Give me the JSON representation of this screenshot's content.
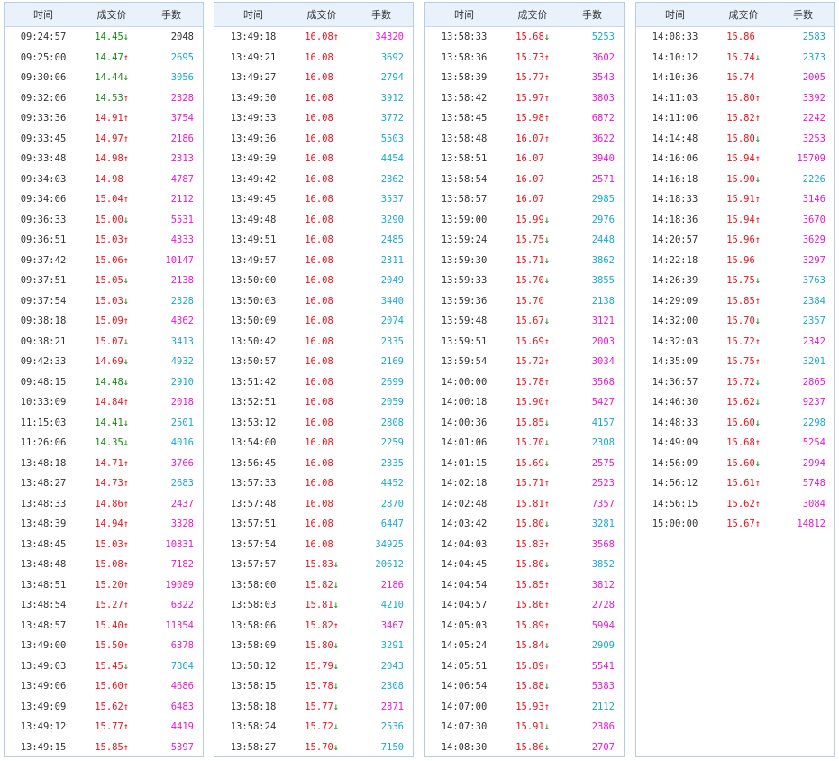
{
  "headers": {
    "time": "时间",
    "price": "成交价",
    "volume": "手数"
  },
  "colors": {
    "up": "#e8141e",
    "down": "#148a14",
    "buy": "#e619d3",
    "sell": "#1ba8cf"
  },
  "panels": [
    [
      [
        "09:24:57",
        "14.45",
        "d",
        "2048",
        "n",
        "g"
      ],
      [
        "09:25:00",
        "14.47",
        "u",
        "2695",
        "s",
        "g"
      ],
      [
        "09:30:06",
        "14.44",
        "d",
        "3056",
        "s",
        "g"
      ],
      [
        "09:32:06",
        "14.53",
        "u",
        "2328",
        "b",
        "g"
      ],
      [
        "09:33:36",
        "14.91",
        "u",
        "3754",
        "b",
        "r"
      ],
      [
        "09:33:45",
        "14.97",
        "u",
        "2186",
        "b",
        "r"
      ],
      [
        "09:33:48",
        "14.98",
        "u",
        "2313",
        "b",
        "r"
      ],
      [
        "09:34:03",
        "14.98",
        "",
        "4787",
        "b",
        "r"
      ],
      [
        "09:34:06",
        "15.04",
        "u",
        "2112",
        "b",
        "r"
      ],
      [
        "09:36:33",
        "15.00",
        "d",
        "5531",
        "b",
        "r"
      ],
      [
        "09:36:51",
        "15.03",
        "u",
        "4333",
        "b",
        "r"
      ],
      [
        "09:37:42",
        "15.06",
        "u",
        "10147",
        "b",
        "r"
      ],
      [
        "09:37:51",
        "15.05",
        "d",
        "2138",
        "b",
        "r"
      ],
      [
        "09:37:54",
        "15.03",
        "d",
        "2328",
        "s",
        "r"
      ],
      [
        "09:38:18",
        "15.09",
        "u",
        "4362",
        "b",
        "r"
      ],
      [
        "09:38:21",
        "15.07",
        "d",
        "3413",
        "s",
        "r"
      ],
      [
        "09:42:33",
        "14.69",
        "d",
        "4932",
        "s",
        "r"
      ],
      [
        "09:48:15",
        "14.48",
        "d",
        "2910",
        "s",
        "g"
      ],
      [
        "10:33:09",
        "14.84",
        "u",
        "2018",
        "b",
        "r"
      ],
      [
        "11:15:03",
        "14.41",
        "d",
        "2501",
        "s",
        "g"
      ],
      [
        "11:26:06",
        "14.35",
        "d",
        "4016",
        "s",
        "g"
      ],
      [
        "13:48:18",
        "14.71",
        "u",
        "3766",
        "b",
        "r"
      ],
      [
        "13:48:27",
        "14.73",
        "u",
        "2683",
        "s",
        "r"
      ],
      [
        "13:48:33",
        "14.86",
        "u",
        "2437",
        "b",
        "r"
      ],
      [
        "13:48:39",
        "14.94",
        "u",
        "3328",
        "b",
        "r"
      ],
      [
        "13:48:45",
        "15.03",
        "u",
        "10831",
        "b",
        "r"
      ],
      [
        "13:48:48",
        "15.08",
        "u",
        "7182",
        "b",
        "r"
      ],
      [
        "13:48:51",
        "15.20",
        "u",
        "19089",
        "b",
        "r"
      ],
      [
        "13:48:54",
        "15.27",
        "u",
        "6822",
        "b",
        "r"
      ],
      [
        "13:48:57",
        "15.40",
        "u",
        "11354",
        "b",
        "r"
      ],
      [
        "13:49:00",
        "15.50",
        "u",
        "6378",
        "b",
        "r"
      ],
      [
        "13:49:03",
        "15.45",
        "d",
        "7864",
        "s",
        "r"
      ],
      [
        "13:49:06",
        "15.60",
        "u",
        "4686",
        "b",
        "r"
      ],
      [
        "13:49:09",
        "15.62",
        "u",
        "6483",
        "b",
        "r"
      ],
      [
        "13:49:12",
        "15.77",
        "u",
        "4419",
        "b",
        "r"
      ],
      [
        "13:49:15",
        "15.85",
        "u",
        "5397",
        "b",
        "r"
      ]
    ],
    [
      [
        "13:49:18",
        "16.08",
        "u",
        "34320",
        "b",
        "r"
      ],
      [
        "13:49:21",
        "16.08",
        "",
        "3692",
        "s",
        "r"
      ],
      [
        "13:49:27",
        "16.08",
        "",
        "2794",
        "s",
        "r"
      ],
      [
        "13:49:30",
        "16.08",
        "",
        "3912",
        "s",
        "r"
      ],
      [
        "13:49:33",
        "16.08",
        "",
        "3772",
        "s",
        "r"
      ],
      [
        "13:49:36",
        "16.08",
        "",
        "5503",
        "s",
        "r"
      ],
      [
        "13:49:39",
        "16.08",
        "",
        "4454",
        "s",
        "r"
      ],
      [
        "13:49:42",
        "16.08",
        "",
        "2862",
        "s",
        "r"
      ],
      [
        "13:49:45",
        "16.08",
        "",
        "3537",
        "s",
        "r"
      ],
      [
        "13:49:48",
        "16.08",
        "",
        "3290",
        "s",
        "r"
      ],
      [
        "13:49:51",
        "16.08",
        "",
        "2485",
        "s",
        "r"
      ],
      [
        "13:49:57",
        "16.08",
        "",
        "2311",
        "s",
        "r"
      ],
      [
        "13:50:00",
        "16.08",
        "",
        "2049",
        "s",
        "r"
      ],
      [
        "13:50:03",
        "16.08",
        "",
        "3440",
        "s",
        "r"
      ],
      [
        "13:50:09",
        "16.08",
        "",
        "2074",
        "s",
        "r"
      ],
      [
        "13:50:42",
        "16.08",
        "",
        "2335",
        "s",
        "r"
      ],
      [
        "13:50:57",
        "16.08",
        "",
        "2169",
        "s",
        "r"
      ],
      [
        "13:51:42",
        "16.08",
        "",
        "2699",
        "s",
        "r"
      ],
      [
        "13:52:51",
        "16.08",
        "",
        "2059",
        "s",
        "r"
      ],
      [
        "13:53:12",
        "16.08",
        "",
        "2808",
        "s",
        "r"
      ],
      [
        "13:54:00",
        "16.08",
        "",
        "2259",
        "s",
        "r"
      ],
      [
        "13:56:45",
        "16.08",
        "",
        "2335",
        "s",
        "r"
      ],
      [
        "13:57:33",
        "16.08",
        "",
        "4452",
        "s",
        "r"
      ],
      [
        "13:57:48",
        "16.08",
        "",
        "2870",
        "s",
        "r"
      ],
      [
        "13:57:51",
        "16.08",
        "",
        "6447",
        "s",
        "r"
      ],
      [
        "13:57:54",
        "16.08",
        "",
        "34925",
        "s",
        "r"
      ],
      [
        "13:57:57",
        "15.83",
        "d",
        "20612",
        "s",
        "r"
      ],
      [
        "13:58:00",
        "15.82",
        "d",
        "2186",
        "b",
        "r"
      ],
      [
        "13:58:03",
        "15.81",
        "d",
        "4210",
        "s",
        "r"
      ],
      [
        "13:58:06",
        "15.82",
        "u",
        "3467",
        "b",
        "r"
      ],
      [
        "13:58:09",
        "15.80",
        "d",
        "3291",
        "s",
        "r"
      ],
      [
        "13:58:12",
        "15.79",
        "d",
        "2043",
        "s",
        "r"
      ],
      [
        "13:58:15",
        "15.78",
        "d",
        "2308",
        "s",
        "r"
      ],
      [
        "13:58:18",
        "15.77",
        "d",
        "2871",
        "b",
        "r"
      ],
      [
        "13:58:24",
        "15.72",
        "d",
        "2536",
        "s",
        "r"
      ],
      [
        "13:58:27",
        "15.70",
        "d",
        "7150",
        "s",
        "r"
      ]
    ],
    [
      [
        "13:58:33",
        "15.68",
        "d",
        "5253",
        "s",
        "r"
      ],
      [
        "13:58:36",
        "15.73",
        "u",
        "3602",
        "b",
        "r"
      ],
      [
        "13:58:39",
        "15.77",
        "u",
        "3543",
        "b",
        "r"
      ],
      [
        "13:58:42",
        "15.97",
        "u",
        "3803",
        "b",
        "r"
      ],
      [
        "13:58:45",
        "15.98",
        "u",
        "6872",
        "b",
        "r"
      ],
      [
        "13:58:48",
        "16.07",
        "u",
        "3622",
        "b",
        "r"
      ],
      [
        "13:58:51",
        "16.07",
        "",
        "3940",
        "b",
        "r"
      ],
      [
        "13:58:54",
        "16.07",
        "",
        "2571",
        "b",
        "r"
      ],
      [
        "13:58:57",
        "16.07",
        "",
        "2985",
        "s",
        "r"
      ],
      [
        "13:59:00",
        "15.99",
        "d",
        "2976",
        "s",
        "r"
      ],
      [
        "13:59:24",
        "15.75",
        "d",
        "2448",
        "s",
        "r"
      ],
      [
        "13:59:30",
        "15.71",
        "d",
        "3862",
        "s",
        "r"
      ],
      [
        "13:59:33",
        "15.70",
        "d",
        "3855",
        "s",
        "r"
      ],
      [
        "13:59:36",
        "15.70",
        "",
        "2138",
        "s",
        "r"
      ],
      [
        "13:59:48",
        "15.67",
        "d",
        "3121",
        "b",
        "r"
      ],
      [
        "13:59:51",
        "15.69",
        "u",
        "2003",
        "b",
        "r"
      ],
      [
        "13:59:54",
        "15.72",
        "u",
        "3034",
        "b",
        "r"
      ],
      [
        "14:00:00",
        "15.78",
        "u",
        "3568",
        "b",
        "r"
      ],
      [
        "14:00:18",
        "15.90",
        "u",
        "5427",
        "b",
        "r"
      ],
      [
        "14:00:36",
        "15.85",
        "d",
        "4157",
        "s",
        "r"
      ],
      [
        "14:01:06",
        "15.70",
        "d",
        "2308",
        "s",
        "r"
      ],
      [
        "14:01:15",
        "15.69",
        "d",
        "2575",
        "b",
        "r"
      ],
      [
        "14:02:18",
        "15.71",
        "u",
        "2523",
        "b",
        "r"
      ],
      [
        "14:02:48",
        "15.81",
        "u",
        "7357",
        "b",
        "r"
      ],
      [
        "14:03:42",
        "15.80",
        "d",
        "3281",
        "s",
        "r"
      ],
      [
        "14:04:03",
        "15.83",
        "u",
        "3568",
        "b",
        "r"
      ],
      [
        "14:04:45",
        "15.80",
        "d",
        "3852",
        "s",
        "r"
      ],
      [
        "14:04:54",
        "15.85",
        "u",
        "3812",
        "b",
        "r"
      ],
      [
        "14:04:57",
        "15.86",
        "u",
        "2728",
        "b",
        "r"
      ],
      [
        "14:05:03",
        "15.89",
        "u",
        "5994",
        "b",
        "r"
      ],
      [
        "14:05:24",
        "15.84",
        "d",
        "2909",
        "s",
        "r"
      ],
      [
        "14:05:51",
        "15.89",
        "u",
        "5541",
        "b",
        "r"
      ],
      [
        "14:06:54",
        "15.88",
        "d",
        "5383",
        "b",
        "r"
      ],
      [
        "14:07:00",
        "15.93",
        "u",
        "2112",
        "s",
        "r"
      ],
      [
        "14:07:30",
        "15.91",
        "d",
        "2386",
        "b",
        "r"
      ],
      [
        "14:08:30",
        "15.86",
        "d",
        "2707",
        "b",
        "r"
      ]
    ],
    [
      [
        "14:08:33",
        "15.86",
        "",
        "2583",
        "s",
        "r"
      ],
      [
        "14:10:12",
        "15.74",
        "d",
        "2373",
        "s",
        "r"
      ],
      [
        "14:10:36",
        "15.74",
        "",
        "2005",
        "b",
        "r"
      ],
      [
        "14:11:03",
        "15.80",
        "u",
        "3392",
        "b",
        "r"
      ],
      [
        "14:11:06",
        "15.82",
        "u",
        "2242",
        "b",
        "r"
      ],
      [
        "14:14:48",
        "15.80",
        "d",
        "3253",
        "b",
        "r"
      ],
      [
        "14:16:06",
        "15.94",
        "u",
        "15709",
        "b",
        "r"
      ],
      [
        "14:16:18",
        "15.90",
        "d",
        "2226",
        "s",
        "r"
      ],
      [
        "14:18:33",
        "15.91",
        "u",
        "3146",
        "b",
        "r"
      ],
      [
        "14:18:36",
        "15.94",
        "u",
        "3670",
        "b",
        "r"
      ],
      [
        "14:20:57",
        "15.96",
        "u",
        "3629",
        "b",
        "r"
      ],
      [
        "14:22:18",
        "15.96",
        "",
        "3297",
        "b",
        "r"
      ],
      [
        "14:26:39",
        "15.75",
        "d",
        "3763",
        "s",
        "r"
      ],
      [
        "14:29:09",
        "15.85",
        "u",
        "2384",
        "s",
        "r"
      ],
      [
        "14:32:00",
        "15.70",
        "d",
        "2357",
        "s",
        "r"
      ],
      [
        "14:32:03",
        "15.72",
        "u",
        "2342",
        "b",
        "r"
      ],
      [
        "14:35:09",
        "15.75",
        "u",
        "3201",
        "s",
        "r"
      ],
      [
        "14:36:57",
        "15.72",
        "d",
        "2865",
        "b",
        "r"
      ],
      [
        "14:46:30",
        "15.62",
        "d",
        "9237",
        "b",
        "r"
      ],
      [
        "14:48:33",
        "15.60",
        "d",
        "2298",
        "s",
        "r"
      ],
      [
        "14:49:09",
        "15.68",
        "u",
        "5254",
        "b",
        "r"
      ],
      [
        "14:56:09",
        "15.60",
        "d",
        "2994",
        "b",
        "r"
      ],
      [
        "14:56:12",
        "15.61",
        "u",
        "5748",
        "b",
        "r"
      ],
      [
        "14:56:15",
        "15.62",
        "u",
        "3084",
        "b",
        "r"
      ],
      [
        "15:00:00",
        "15.67",
        "u",
        "14812",
        "b",
        "r"
      ]
    ]
  ]
}
